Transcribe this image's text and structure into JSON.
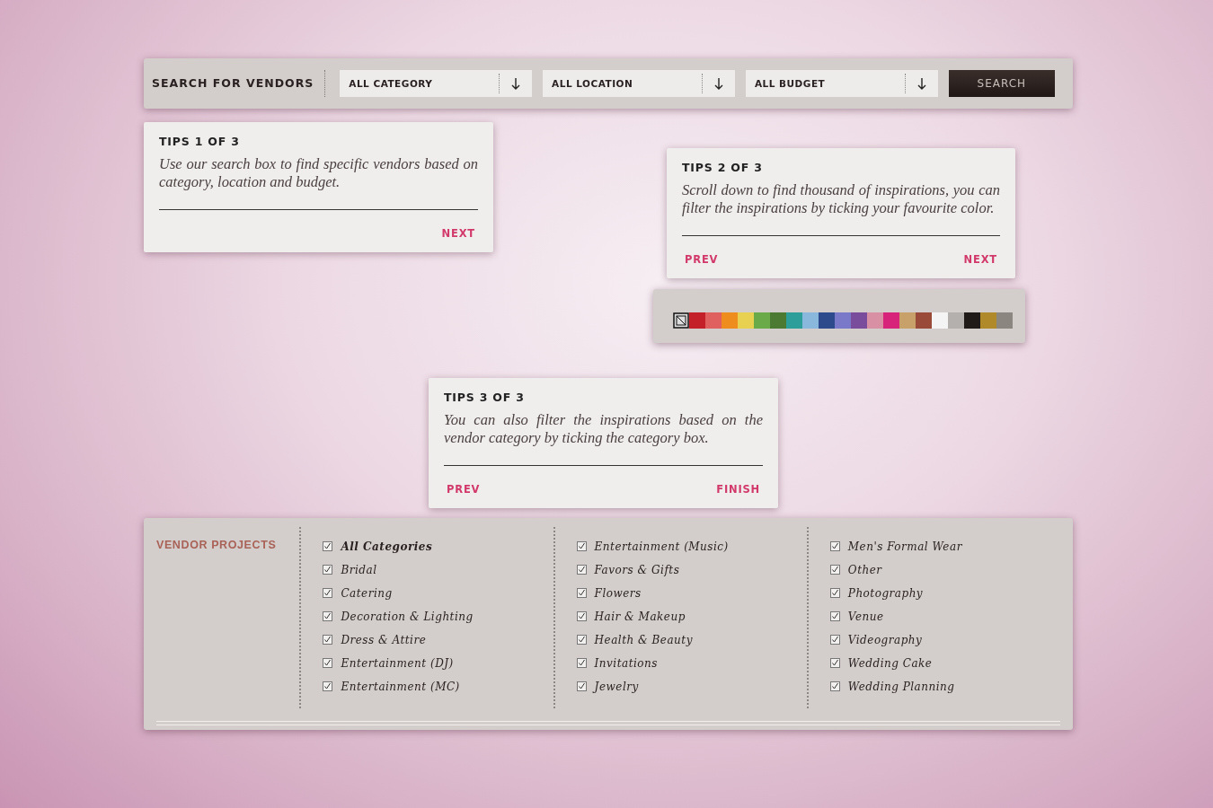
{
  "search_bar": {
    "title": "SEARCH FOR VENDORS",
    "dropdowns": [
      {
        "label": "ALL CATEGORY"
      },
      {
        "label": "ALL LOCATION"
      },
      {
        "label": "ALL BUDGET"
      }
    ],
    "button": "SEARCH"
  },
  "tips": [
    {
      "title": "TIPS 1 OF 3",
      "text": "Use our search box to find specific vendors based on category, location and budget.",
      "next": "NEXT"
    },
    {
      "title": "TIPS 2 OF 3",
      "text": "Scroll down to find thousand of inspirations, you can filter the inspirations by ticking your favourite color.",
      "prev": "PREV",
      "next": "NEXT"
    },
    {
      "title": "TIPS 3 OF 3",
      "text": "You can also filter the inspirations based on the vendor category by ticking the category box.",
      "prev": "PREV",
      "next": "FINISH"
    }
  ],
  "color_filter": [
    {
      "kind": "none"
    },
    {
      "kind": "solid",
      "color": "#c4202a"
    },
    {
      "kind": "solid",
      "color": "#e06060"
    },
    {
      "kind": "solid",
      "color": "#ef8c1e"
    },
    {
      "kind": "solid",
      "color": "#e8d050"
    },
    {
      "kind": "solid",
      "color": "#6aaa48"
    },
    {
      "kind": "solid",
      "color": "#4c7a32"
    },
    {
      "kind": "solid",
      "color": "#2e9e9a"
    },
    {
      "kind": "solid",
      "color": "#8ab8dc"
    },
    {
      "kind": "solid",
      "color": "#2c4a8c"
    },
    {
      "kind": "solid",
      "color": "#7a78c8"
    },
    {
      "kind": "solid",
      "color": "#7a4c9c"
    },
    {
      "kind": "solid",
      "color": "#d890a4"
    },
    {
      "kind": "solid",
      "color": "#d8237a"
    },
    {
      "kind": "solid",
      "color": "#c8a06a"
    },
    {
      "kind": "solid",
      "color": "#9a4a38"
    },
    {
      "kind": "solid",
      "color": "#f4f4f4"
    },
    {
      "kind": "solid",
      "color": "#b4b0ae"
    },
    {
      "kind": "solid",
      "color": "#201a18"
    },
    {
      "kind": "solid",
      "color": "#b08a2a"
    },
    {
      "kind": "solid",
      "color": "#8c8680"
    }
  ],
  "vendor_projects": {
    "title": "VENDOR PROJECTS",
    "columns": [
      [
        {
          "label": "All Categories",
          "checked": true,
          "bold": true
        },
        {
          "label": "Bridal",
          "checked": true,
          "bold": false
        },
        {
          "label": "Catering",
          "checked": true,
          "bold": false
        },
        {
          "label": "Decoration & Lighting",
          "checked": true,
          "bold": false
        },
        {
          "label": "Dress & Attire",
          "checked": true,
          "bold": false
        },
        {
          "label": "Entertainment (DJ)",
          "checked": true,
          "bold": false
        },
        {
          "label": "Entertainment (MC)",
          "checked": true,
          "bold": false
        }
      ],
      [
        {
          "label": "Entertainment (Music)",
          "checked": true,
          "bold": false
        },
        {
          "label": "Favors & Gifts",
          "checked": true,
          "bold": false
        },
        {
          "label": "Flowers",
          "checked": true,
          "bold": false
        },
        {
          "label": "Hair & Makeup",
          "checked": true,
          "bold": false
        },
        {
          "label": "Health & Beauty",
          "checked": true,
          "bold": false
        },
        {
          "label": "Invitations",
          "checked": true,
          "bold": false
        },
        {
          "label": "Jewelry",
          "checked": true,
          "bold": false
        }
      ],
      [
        {
          "label": "Men's Formal Wear",
          "checked": true,
          "bold": false
        },
        {
          "label": "Other",
          "checked": true,
          "bold": false
        },
        {
          "label": "Photography",
          "checked": true,
          "bold": false
        },
        {
          "label": "Venue",
          "checked": true,
          "bold": false
        },
        {
          "label": "Videography",
          "checked": true,
          "bold": false
        },
        {
          "label": "Wedding Cake",
          "checked": true,
          "bold": false
        },
        {
          "label": "Wedding Planning",
          "checked": true,
          "bold": false
        }
      ]
    ]
  }
}
